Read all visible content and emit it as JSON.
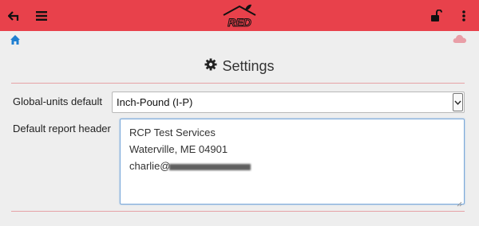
{
  "header": {
    "back_icon": "back-arrow-icon",
    "menu_icon": "hamburger-menu-icon",
    "logo_text": "RED",
    "lock_icon": "unlock-icon",
    "more_icon": "vertical-dots-icon",
    "bar_color": "#e8414b"
  },
  "subbar": {
    "home_icon": "home-icon",
    "cloud_icon": "cloud-icon"
  },
  "page": {
    "title": "Settings",
    "title_icon": "gear-icon"
  },
  "form": {
    "global_units_label": "Global-units default",
    "global_units_value": "Inch-Pound (I-P)",
    "report_header_label": "Default report header",
    "report_header_lines": [
      "RCP Test Services",
      "Waterville, ME 04901",
      "charlie@"
    ]
  }
}
